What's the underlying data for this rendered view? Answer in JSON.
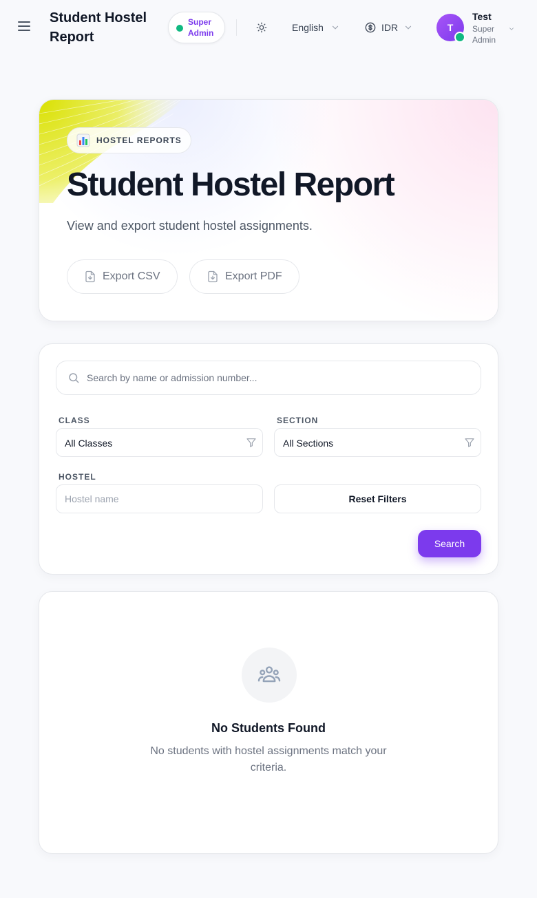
{
  "header": {
    "title": "Student Hostel Report",
    "role_badge": "Super Admin",
    "language": "English",
    "currency": "IDR",
    "user": {
      "initial": "T",
      "name": "Test",
      "role": "Super Admin"
    }
  },
  "hero": {
    "badge_icon": "bar-chart-emoji",
    "badge_label": "HOSTEL REPORTS",
    "title": "Student Hostel Report",
    "subtitle": "View and export student hostel assignments.",
    "export_csv_label": "Export CSV",
    "export_pdf_label": "Export PDF"
  },
  "filters": {
    "search_placeholder": "Search by name or admission number...",
    "class_label": "CLASS",
    "class_value": "All Classes",
    "section_label": "SECTION",
    "section_value": "All Sections",
    "hostel_label": "HOSTEL",
    "hostel_placeholder": "Hostel name",
    "reset_label": "Reset Filters",
    "search_label": "Search"
  },
  "empty_state": {
    "icon": "users-group-icon",
    "title": "No Students Found",
    "description": "No students with hostel assignments match your criteria."
  },
  "colors": {
    "accent": "#7c3aed",
    "status_online": "#10b981",
    "background": "#f8f9fc"
  }
}
